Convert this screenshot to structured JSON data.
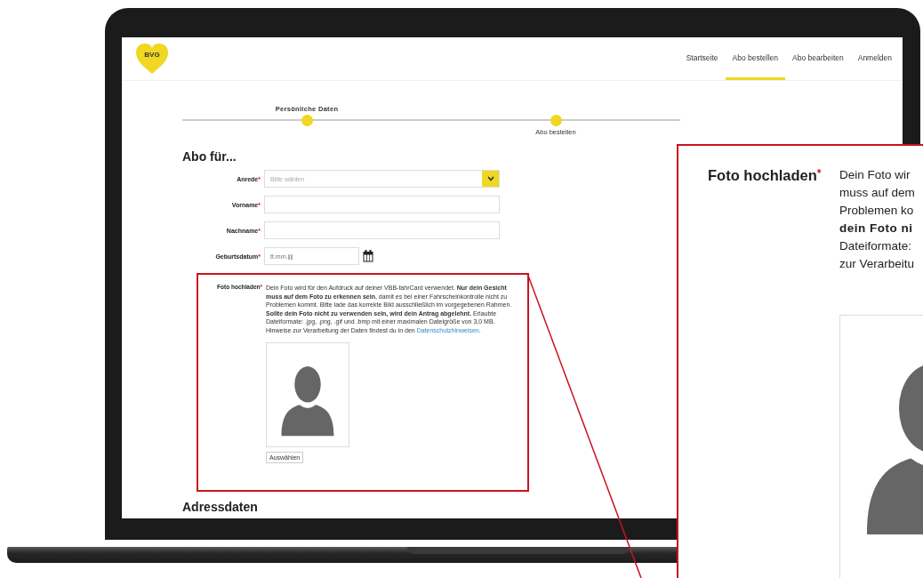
{
  "header": {
    "logo": "BVG",
    "nav": [
      {
        "label": "Startseite",
        "selected": false
      },
      {
        "label": "Abo bestellen",
        "selected": true
      },
      {
        "label": "Abo bearbeiten",
        "selected": false
      },
      {
        "label": "Anmelden",
        "selected": false
      }
    ]
  },
  "steps": [
    {
      "label": "Persönliche Daten"
    },
    {
      "label": "Abo bestellen"
    }
  ],
  "form": {
    "title": "Abo für...",
    "required_mark": "*",
    "fields": [
      {
        "kind": "select",
        "label": "Anrede",
        "required": true,
        "placeholder": "Bitte wählen"
      },
      {
        "kind": "text",
        "label": "Vorname",
        "required": true
      },
      {
        "kind": "text",
        "label": "Nachname",
        "required": true
      },
      {
        "kind": "date",
        "label": "Geburtsdatum",
        "required": true,
        "placeholder": "tt.mm.jjjj"
      }
    ],
    "photo_upload": {
      "label": "Foto hochladen",
      "required": true,
      "description": "Dein Foto wird für den Aufdruck auf deiner VBB-fahrCard verwendet. **Nur dein Gesicht muss auf dem Foto zu erkennen sein**, damit es bei einer Fahrscheinkontrolle nicht zu Problemen kommt. Bitte lade das korrekte Bild ausschließlich im vorgegebenen Rahmen. **Sollte dein Foto nicht zu verwenden sein, wird dein Antrag abgelehnt.** Erlaubte Dateiformate: .jpg, .png, .gif und .bmp mit einer maximalen Dateigröße von 3,0 MB. Hinweise zur Verarbeitung der Daten findest du in den ",
      "link": "Datenschutzhinweisen",
      "description_end": ".",
      "button": "Auswählen"
    },
    "next_section": "Adressdaten"
  },
  "zoom_inset": {
    "label": "Foto hochladen",
    "required": true,
    "lines": [
      {
        "text": "Dein Foto wir",
        "bold": false
      },
      {
        "text": "muss auf dem",
        "bold": false
      },
      {
        "text": "Problemen ko",
        "bold": false
      },
      {
        "text": "dein Foto ni",
        "bold": true
      },
      {
        "text": "Dateiformate:",
        "bold": false
      },
      {
        "text": "zur Verarbeitu",
        "bold": false
      }
    ]
  }
}
